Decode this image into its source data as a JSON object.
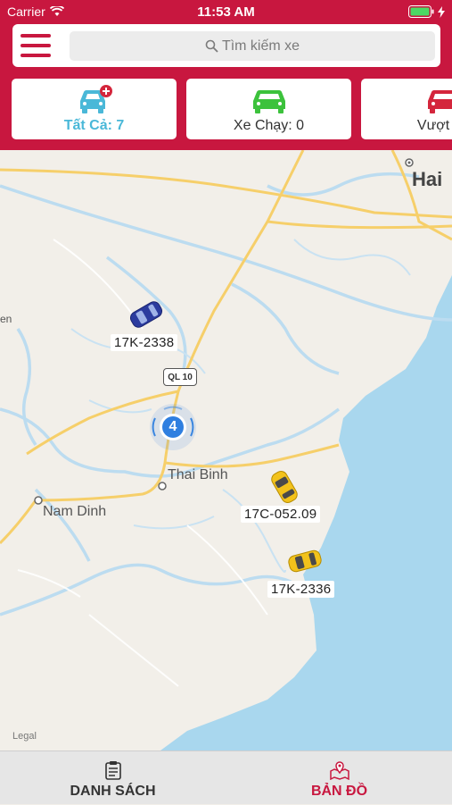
{
  "status": {
    "carrier": "Carrier",
    "time": "11:53 AM"
  },
  "search": {
    "placeholder": "Tìm kiếm xe"
  },
  "filters": [
    {
      "label": "Tất Cả: 7",
      "color": "#4ab8d8",
      "icon": "car-plus-icon"
    },
    {
      "label": "Xe Chạy: 0",
      "color": "#3cc23c",
      "icon": "car-icon"
    },
    {
      "label": "Vượt Tố",
      "color": "#d4263c",
      "icon": "car-icon"
    }
  ],
  "map": {
    "places": {
      "hai": "Hai",
      "thai_binh": "Thai Binh",
      "nam_dinh": "Nam Dinh",
      "en": "en"
    },
    "road_sign": "QL 10",
    "cluster_count": "4",
    "vehicles": [
      {
        "plate": "17K-2338",
        "color": "#2b3b9e"
      },
      {
        "plate": "17C-052.09",
        "color": "#f2c21b"
      },
      {
        "plate": "17K-2336",
        "color": "#f2c21b"
      }
    ],
    "legal": "Legal"
  },
  "tabs": [
    {
      "label": "DANH SÁCH",
      "icon": "clipboard-list-icon",
      "color": "#333333"
    },
    {
      "label": "BẢN ĐỒ",
      "icon": "map-pin-icon",
      "color": "#c8173f"
    }
  ],
  "colors": {
    "brand": "#c8173f",
    "water": "#a9d7ee",
    "land": "#f2efe9"
  }
}
